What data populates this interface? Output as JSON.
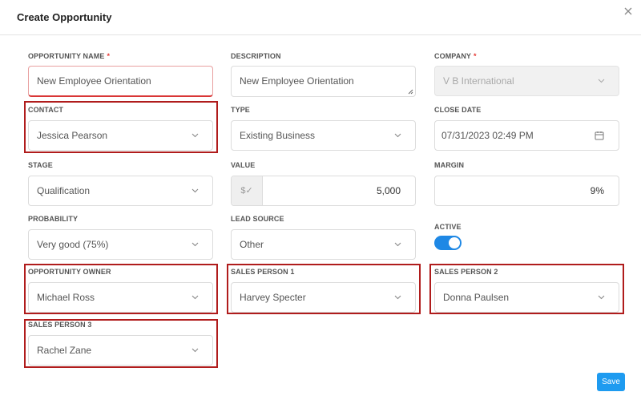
{
  "dialog": {
    "title": "Create Opportunity"
  },
  "fields": {
    "opportunity_name": {
      "label": "OPPORTUNITY NAME",
      "required_mark": "*",
      "value": "New Employee Orientation"
    },
    "description": {
      "label": "DESCRIPTION",
      "value": "New Employee Orientation"
    },
    "company": {
      "label": "COMPANY",
      "required_mark": "*",
      "value": "V B International"
    },
    "contact": {
      "label": "CONTACT",
      "value": "Jessica Pearson"
    },
    "type": {
      "label": "TYPE",
      "value": "Existing Business"
    },
    "close_date": {
      "label": "CLOSE DATE",
      "value": "07/31/2023 02:49 PM"
    },
    "stage": {
      "label": "STAGE",
      "value": "Qualification"
    },
    "value": {
      "label": "VALUE",
      "prefix": "$✓",
      "value": "5,000"
    },
    "margin": {
      "label": "MARGIN",
      "value": "9%"
    },
    "probability": {
      "label": "PROBABILITY",
      "value": "Very good (75%)"
    },
    "lead_source": {
      "label": "LEAD SOURCE",
      "value": "Other"
    },
    "active": {
      "label": "ACTIVE",
      "on": true
    },
    "opportunity_owner": {
      "label": "OPPORTUNITY OWNER",
      "value": "Michael Ross"
    },
    "sales_person_1": {
      "label": "SALES PERSON 1",
      "value": "Harvey Specter"
    },
    "sales_person_2": {
      "label": "SALES PERSON 2",
      "value": "Donna Paulsen"
    },
    "sales_person_3": {
      "label": "SALES PERSON 3",
      "value": "Rachel Zane"
    }
  },
  "buttons": {
    "save": "Save"
  },
  "colors": {
    "accent": "#1e9bf0",
    "toggle": "#1e88e5",
    "highlight": "#b01c1c",
    "required": "#e53935"
  },
  "icons": {
    "close": "close-icon",
    "dropdown": "chevron-down-icon",
    "calendar": "calendar-icon"
  }
}
